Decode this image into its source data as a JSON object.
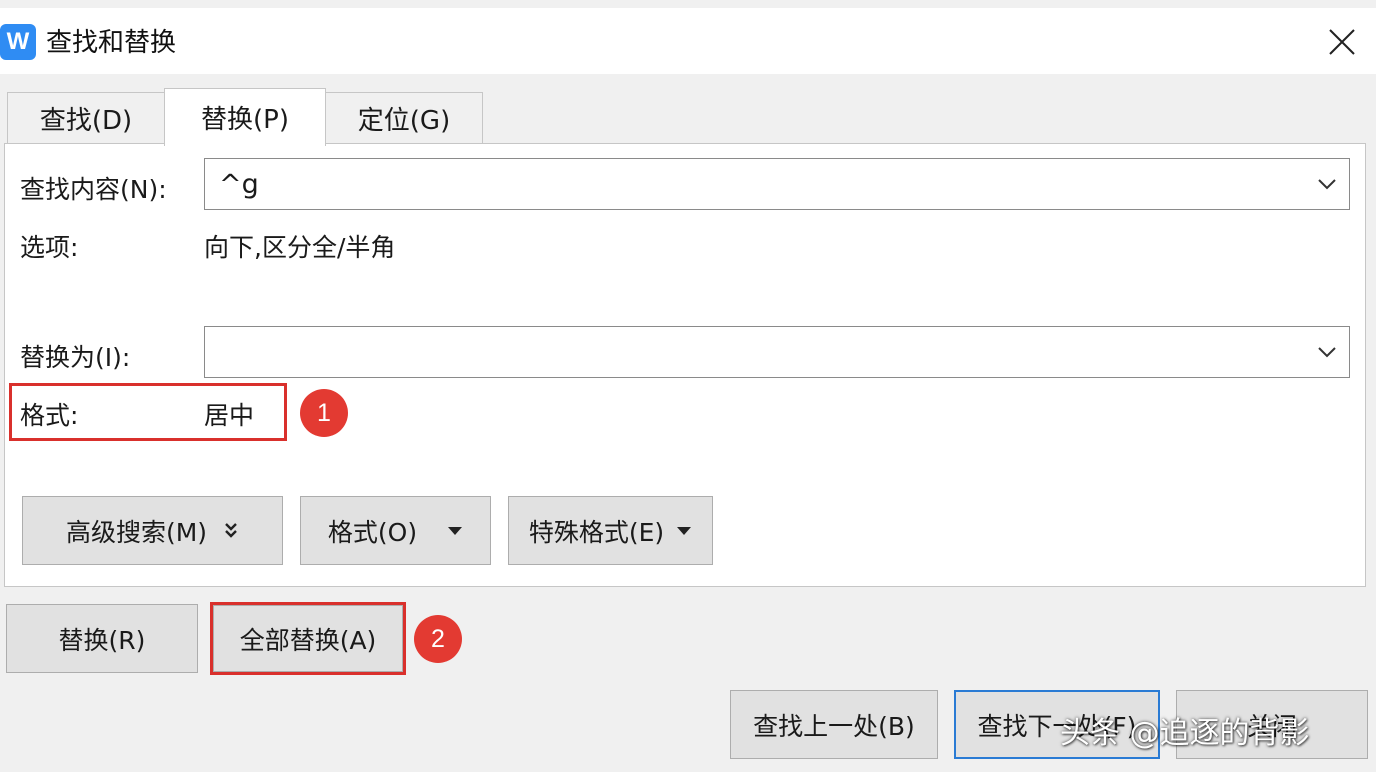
{
  "window": {
    "title": "查找和替换",
    "app_icon": "wps-writer-icon",
    "close_icon": "close-icon"
  },
  "tabs": [
    {
      "label": "查找(D)",
      "active": false
    },
    {
      "label": "替换(P)",
      "active": true
    },
    {
      "label": "定位(G)",
      "active": false
    }
  ],
  "find": {
    "label": "查找内容(N):",
    "value": "^g"
  },
  "options": {
    "label": "选项:",
    "value": "向下,区分全/半角"
  },
  "replace": {
    "label": "替换为(I):",
    "value": ""
  },
  "format": {
    "label": "格式:",
    "value": "居中"
  },
  "annotations": {
    "badge1": "1",
    "badge2": "2",
    "highlight_color": "#d9302c",
    "badge_color": "#e33a32"
  },
  "panel_buttons": {
    "advanced": "高级搜索(M)",
    "format": "格式(O)",
    "special": "特殊格式(E)"
  },
  "actions": {
    "replace": "替换(R)",
    "replace_all": "全部替换(A)",
    "find_prev": "查找上一处(B)",
    "find_next": "查找下一处(F)",
    "close": "关闭"
  },
  "watermark": "头条 @追逐的背影"
}
